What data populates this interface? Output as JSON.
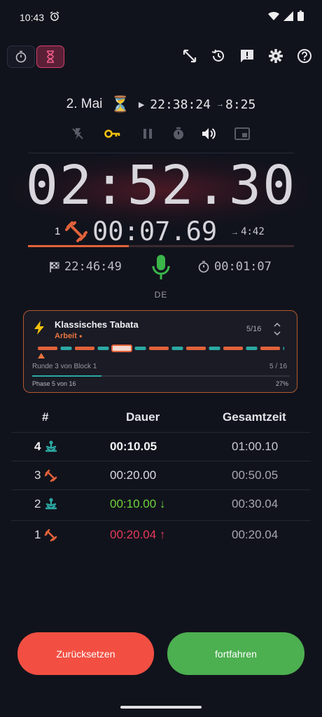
{
  "status": {
    "time": "10:43"
  },
  "info": {
    "date": "2. Mai",
    "start_time": "22:38:24",
    "end_short": "8:25"
  },
  "main": {
    "time": "02:52.30"
  },
  "sub": {
    "round": "1",
    "time": "00:07.69",
    "remaining": "4:42",
    "progress_fraction": 0.38
  },
  "end_time": "22:46:49",
  "elapsed": "00:01:07",
  "language": "DE",
  "card": {
    "title": "Klassisches Tabata",
    "phase_name": "Arbeit",
    "counter": "5/16",
    "round_label": "Runde 3 von Block 1",
    "round_count": "5 / 16",
    "phase_label": "Phase 5 von 16",
    "percent": "27%",
    "phase_progress_fraction": 0.27,
    "segments": [
      "work",
      "rest",
      "work",
      "rest",
      "current",
      "rest",
      "work",
      "rest",
      "work",
      "rest",
      "work",
      "rest",
      "work",
      "rest",
      "work",
      "rest"
    ]
  },
  "table": {
    "headers": [
      "#",
      "Dauer",
      "Gesamtzeit"
    ],
    "rows": [
      {
        "num": "4",
        "type": "rest",
        "duration": "00:10.05",
        "total": "01:00.10",
        "style": "current"
      },
      {
        "num": "3",
        "type": "work",
        "duration": "00:20.00",
        "total": "00:50.05",
        "style": "normal"
      },
      {
        "num": "2",
        "type": "rest",
        "duration": "00:10.00 ↓",
        "total": "00:30.04",
        "style": "faster"
      },
      {
        "num": "1",
        "type": "work",
        "duration": "00:20.04 ↑",
        "total": "00:20.04",
        "style": "slower"
      }
    ]
  },
  "buttons": {
    "reset": "Zurücksetzen",
    "continue": "fortfahren"
  },
  "colors": {
    "work": "#e2623a",
    "rest": "#2ba9a3",
    "reset": "#f24f42",
    "continue": "#4caf50",
    "faster": "#6ed33a",
    "slower": "#e8395a"
  }
}
